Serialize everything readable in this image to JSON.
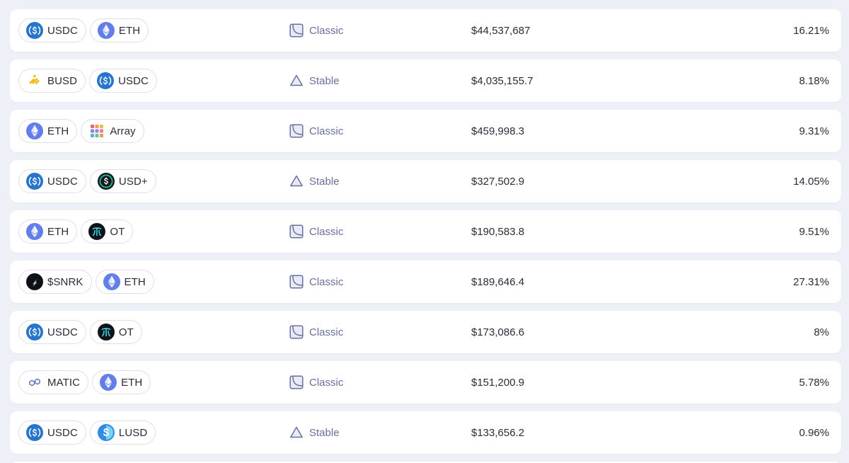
{
  "pools": [
    {
      "tokens": [
        {
          "symbol": "USDC",
          "icon": "usdc-icon"
        },
        {
          "symbol": "ETH",
          "icon": "eth-icon"
        }
      ],
      "type": "Classic",
      "type_icon": "classic-icon",
      "tvl": "$44,537,687",
      "apr": "16.21%"
    },
    {
      "tokens": [
        {
          "symbol": "BUSD",
          "icon": "busd-icon"
        },
        {
          "symbol": "USDC",
          "icon": "usdc-icon"
        }
      ],
      "type": "Stable",
      "type_icon": "stable-icon",
      "tvl": "$4,035,155.7",
      "apr": "8.18%"
    },
    {
      "tokens": [
        {
          "symbol": "ETH",
          "icon": "eth-icon"
        },
        {
          "symbol": "Array",
          "icon": "array-icon"
        }
      ],
      "type": "Classic",
      "type_icon": "classic-icon",
      "tvl": "$459,998.3",
      "apr": "9.31%"
    },
    {
      "tokens": [
        {
          "symbol": "USDC",
          "icon": "usdc-icon"
        },
        {
          "symbol": "USD+",
          "icon": "usdplus-icon"
        }
      ],
      "type": "Stable",
      "type_icon": "stable-icon",
      "tvl": "$327,502.9",
      "apr": "14.05%"
    },
    {
      "tokens": [
        {
          "symbol": "ETH",
          "icon": "eth-icon"
        },
        {
          "symbol": "OT",
          "icon": "ot-icon"
        }
      ],
      "type": "Classic",
      "type_icon": "classic-icon",
      "tvl": "$190,583.8",
      "apr": "9.51%"
    },
    {
      "tokens": [
        {
          "symbol": "$SNRK",
          "icon": "snrk-icon"
        },
        {
          "symbol": "ETH",
          "icon": "eth-icon"
        }
      ],
      "type": "Classic",
      "type_icon": "classic-icon",
      "tvl": "$189,646.4",
      "apr": "27.31%"
    },
    {
      "tokens": [
        {
          "symbol": "USDC",
          "icon": "usdc-icon"
        },
        {
          "symbol": "OT",
          "icon": "ot-icon"
        }
      ],
      "type": "Classic",
      "type_icon": "classic-icon",
      "tvl": "$173,086.6",
      "apr": "8%"
    },
    {
      "tokens": [
        {
          "symbol": "MATIC",
          "icon": "matic-icon"
        },
        {
          "symbol": "ETH",
          "icon": "eth-icon"
        }
      ],
      "type": "Classic",
      "type_icon": "classic-icon",
      "tvl": "$151,200.9",
      "apr": "5.78%"
    },
    {
      "tokens": [
        {
          "symbol": "USDC",
          "icon": "usdc-icon"
        },
        {
          "symbol": "LUSD",
          "icon": "lusd-icon"
        }
      ],
      "type": "Stable",
      "type_icon": "stable-icon",
      "tvl": "$133,656.2",
      "apr": "0.96%"
    }
  ],
  "colors": {
    "background": "#eef0f8",
    "row": "#ffffff",
    "pill_border": "#dcdfea",
    "type_text": "#6b6f9c",
    "text": "#2b2b3a",
    "usdc": "#2775ca",
    "eth": "#627eea",
    "busd": "#f0b90b",
    "ot": "#101418",
    "ot_accent": "#3fd3e6"
  }
}
